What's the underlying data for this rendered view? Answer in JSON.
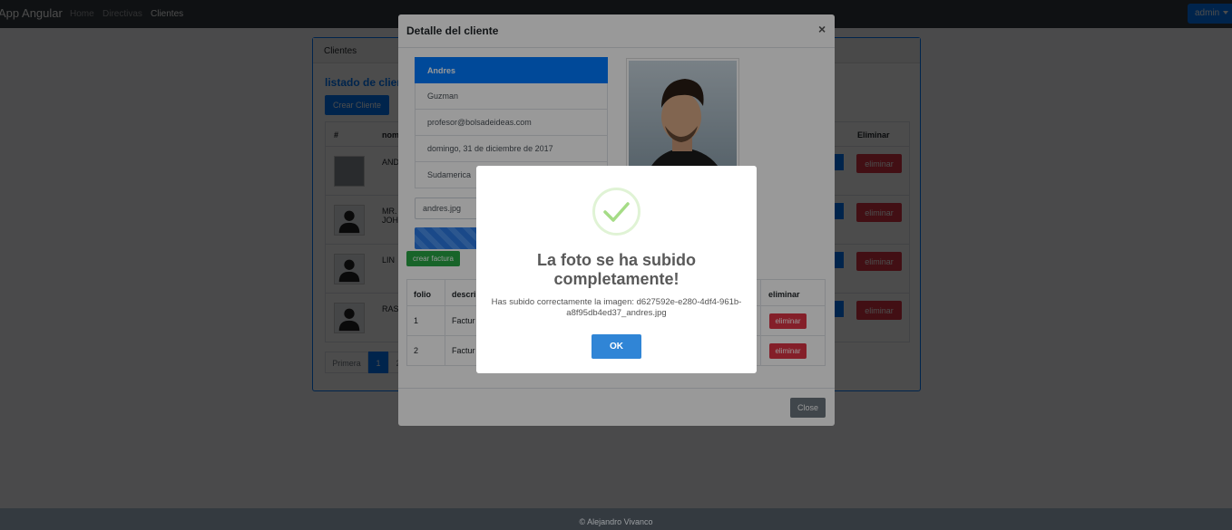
{
  "navbar": {
    "brand": "App Angular",
    "links": [
      "Home",
      "Directivas",
      "Clientes"
    ],
    "user_menu": "admin"
  },
  "footer": {
    "text": "© Alejandro Vivanco"
  },
  "card": {
    "header": "Clientes",
    "title": "listado de clien",
    "create_button": "Crear Cliente",
    "columns": [
      "#",
      "nom",
      "Eliminar"
    ],
    "rows": [
      {
        "name": "AND",
        "delete_label": "eliminar"
      },
      {
        "name": "MR.",
        "name2": "JOH",
        "delete_label": "eliminar"
      },
      {
        "name": "LIN",
        "delete_label": "eliminar"
      },
      {
        "name": "RAS",
        "delete_label": "eliminar"
      }
    ],
    "pagination": [
      "Primera",
      "1",
      "2"
    ]
  },
  "modal": {
    "title": "Detalle del cliente",
    "close_symbol": "×",
    "details": [
      "Andres",
      "Guzman",
      "profesor@bolsadeideas.com",
      "domingo, 31 de diciembre de 2017",
      "Sudamerica"
    ],
    "file_name": "andres.jpg",
    "create_invoice_button": "crear factura",
    "invoice_columns": [
      "folio",
      "descri",
      "eliminar"
    ],
    "invoices": [
      {
        "folio": "1",
        "descripcion": "Factur",
        "delete_label": "eliminar"
      },
      {
        "folio": "2",
        "descripcion": "Factur",
        "delete_label": "eliminar"
      }
    ],
    "close_button": "Close"
  },
  "alert": {
    "title": "La foto se ha subido completamente!",
    "text": "Has subido correctamente la imagen: d627592e-e280-4df4-961b-a8f95db4ed37_andres.jpg",
    "confirm_button": "OK",
    "icon": "check-icon"
  },
  "colors": {
    "primary": "#007bff",
    "danger": "#dc3545",
    "success": "#28a745",
    "dark": "#343a40",
    "swal_confirm": "#3085d6"
  }
}
